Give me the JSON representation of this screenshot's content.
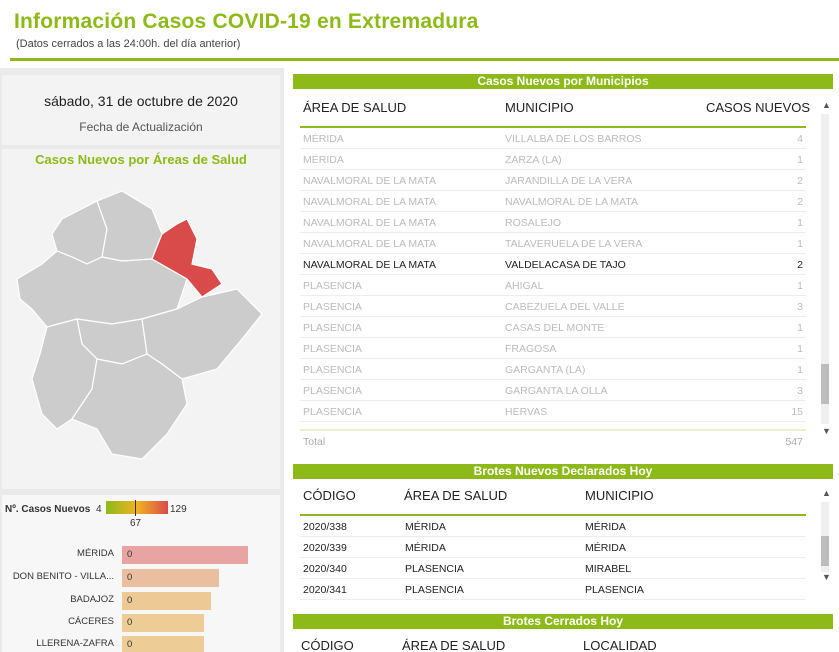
{
  "header": {
    "title": "Información Casos COVID-19 en Extremadura",
    "subtitle": "(Datos cerrados a las 24:00h. del día anterior)"
  },
  "date_card": {
    "value": "sábado, 31 de octubre de 2020",
    "label": "Fecha de Actualización"
  },
  "map": {
    "title": "Casos Nuevos por Áreas de Salud",
    "highlight_color": "#d94a4a",
    "region_color": "#cccccc"
  },
  "legend": {
    "label": "Nº. Casos Nuevos",
    "min": "4",
    "mid": "67",
    "max": "129"
  },
  "bars": [
    {
      "name": "MÉRIDA",
      "value": "0",
      "fraction": 1.0,
      "color": "#e8a3a3"
    },
    {
      "name": "DON BENITO - VILLA...",
      "value": "0",
      "fraction": 0.77,
      "color": "#eabf9f"
    },
    {
      "name": "BADAJOZ",
      "value": "0",
      "fraction": 0.71,
      "color": "#edca95"
    },
    {
      "name": "CÁCERES",
      "value": "0",
      "fraction": 0.65,
      "color": "#eecc95"
    },
    {
      "name": "LLERENA-ZAFRA",
      "value": "0",
      "fraction": 0.65,
      "color": "#eecc95"
    }
  ],
  "municipios": {
    "title": "Casos Nuevos por Municipios",
    "columns": [
      "ÁREA DE SALUD",
      "MUNICIPIO",
      "CASOS NUEVOS"
    ],
    "rows": [
      {
        "area": "MÉRIDA",
        "municipio": "VILLALBA DE LOS BARROS",
        "casos": "4",
        "active": false
      },
      {
        "area": "MÉRIDA",
        "municipio": "ZARZA (LA)",
        "casos": "1",
        "active": false
      },
      {
        "area": "NAVALMORAL DE LA MATA",
        "municipio": "JARANDILLA DE LA VERA",
        "casos": "2",
        "active": false
      },
      {
        "area": "NAVALMORAL DE LA MATA",
        "municipio": "NAVALMORAL DE LA MATA",
        "casos": "2",
        "active": false
      },
      {
        "area": "NAVALMORAL DE LA MATA",
        "municipio": "ROSALEJO",
        "casos": "1",
        "active": false
      },
      {
        "area": "NAVALMORAL DE LA MATA",
        "municipio": "TALAVERUELA DE LA VERA",
        "casos": "1",
        "active": false
      },
      {
        "area": "NAVALMORAL DE LA MATA",
        "municipio": "VALDELACASA DE TAJO",
        "casos": "2",
        "active": true
      },
      {
        "area": "PLASENCIA",
        "municipio": "AHIGAL",
        "casos": "1",
        "active": false
      },
      {
        "area": "PLASENCIA",
        "municipio": "CABEZUELA DEL VALLE",
        "casos": "3",
        "active": false
      },
      {
        "area": "PLASENCIA",
        "municipio": "CASAS DEL MONTE",
        "casos": "1",
        "active": false
      },
      {
        "area": "PLASENCIA",
        "municipio": "FRAGOSA",
        "casos": "1",
        "active": false
      },
      {
        "area": "PLASENCIA",
        "municipio": "GARGANTA (LA)",
        "casos": "1",
        "active": false
      },
      {
        "area": "PLASENCIA",
        "municipio": "GARGANTA LA OLLA",
        "casos": "3",
        "active": false
      },
      {
        "area": "PLASENCIA",
        "municipio": "HERVAS",
        "casos": "15",
        "active": false
      }
    ],
    "total_label": "Total",
    "total_value": "547"
  },
  "brotes_nuevos": {
    "title": "Brotes Nuevos Declarados Hoy",
    "columns": [
      "CÓDIGO",
      "ÁREA DE SALUD",
      "MUNICIPIO"
    ],
    "rows": [
      {
        "codigo": "2020/338",
        "area": "MÉRIDA",
        "municipio": "MÉRIDA"
      },
      {
        "codigo": "2020/339",
        "area": "MÉRIDA",
        "municipio": "MÉRIDA"
      },
      {
        "codigo": "2020/340",
        "area": "PLASENCIA",
        "municipio": "MIRABEL"
      },
      {
        "codigo": "2020/341",
        "area": "PLASENCIA",
        "municipio": "PLASENCIA"
      }
    ]
  },
  "brotes_cerrados": {
    "title": "Brotes Cerrados Hoy",
    "columns": [
      "CÓDIGO",
      "ÁREA DE SALUD",
      "LOCALIDAD"
    ]
  },
  "icons": {
    "scroll_up": "▲",
    "scroll_down": "▼"
  }
}
